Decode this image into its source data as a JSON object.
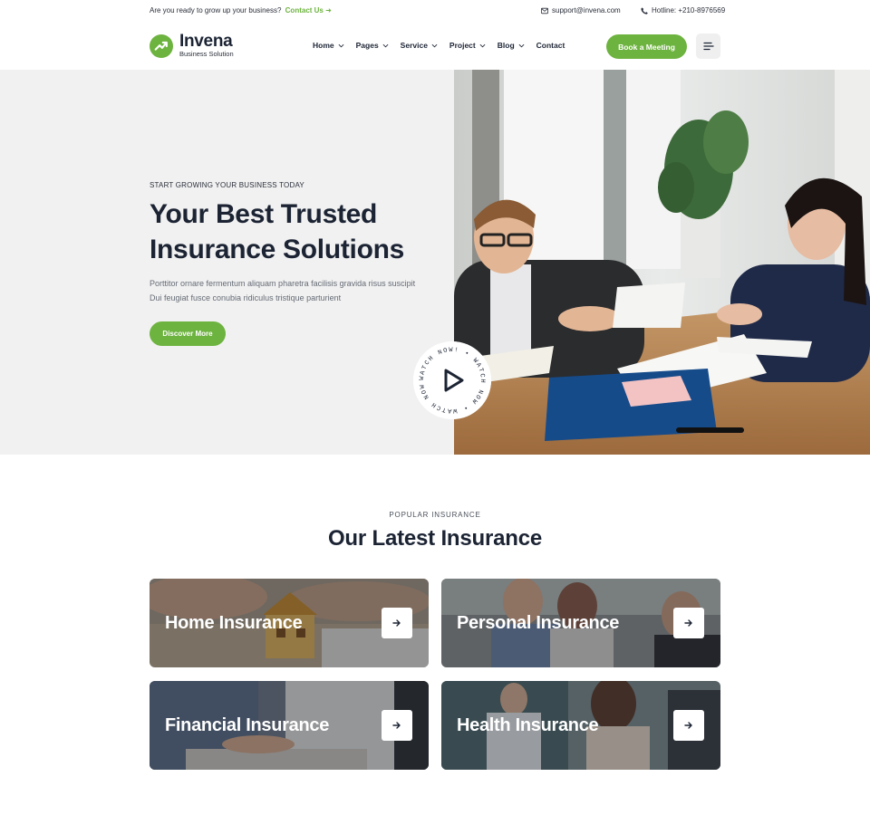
{
  "topbar": {
    "tagline": "Are you ready to grow up your business?",
    "contact_link": "Contact Us",
    "email": "support@invena.com",
    "hotline": "Hotline: +210-8976569"
  },
  "header": {
    "brand_name": "Invena",
    "brand_sub": "Business Solution",
    "nav": [
      {
        "label": "Home"
      },
      {
        "label": "Pages"
      },
      {
        "label": "Service"
      },
      {
        "label": "Project"
      },
      {
        "label": "Blog"
      },
      {
        "label": "Contact"
      }
    ],
    "cta": "Book a Meeting"
  },
  "hero": {
    "eyebrow": "START GROWING YOUR BUSINESS TODAY",
    "title_line1": "Your Best Trusted",
    "title_line2": "Insurance Solutions",
    "desc_line1": "Porttitor ornare fermentum aliquam pharetra facilisis gravida risus suscipit",
    "desc_line2": "Dui feugiat fusce conubia ridiculus tristique parturient",
    "button": "Discover More",
    "watch_text": "WATCH NOW! • WATCH NOW • WATCH NOW •"
  },
  "section": {
    "eyebrow": "POPULAR INSURANCE",
    "title": "Our Latest Insurance",
    "cards": [
      {
        "title": "Home Insurance"
      },
      {
        "title": "Personal Insurance"
      },
      {
        "title": "Financial Insurance"
      },
      {
        "title": "Health Insurance"
      }
    ]
  },
  "colors": {
    "accent": "#6db33f",
    "heading": "#1c2434",
    "hero_bg": "#f1f1f1"
  },
  "icons": {
    "email": "envelope-icon",
    "phone": "phone-icon",
    "menu": "menu-lines-icon",
    "play": "play-icon",
    "arrow": "arrow-right-icon"
  }
}
